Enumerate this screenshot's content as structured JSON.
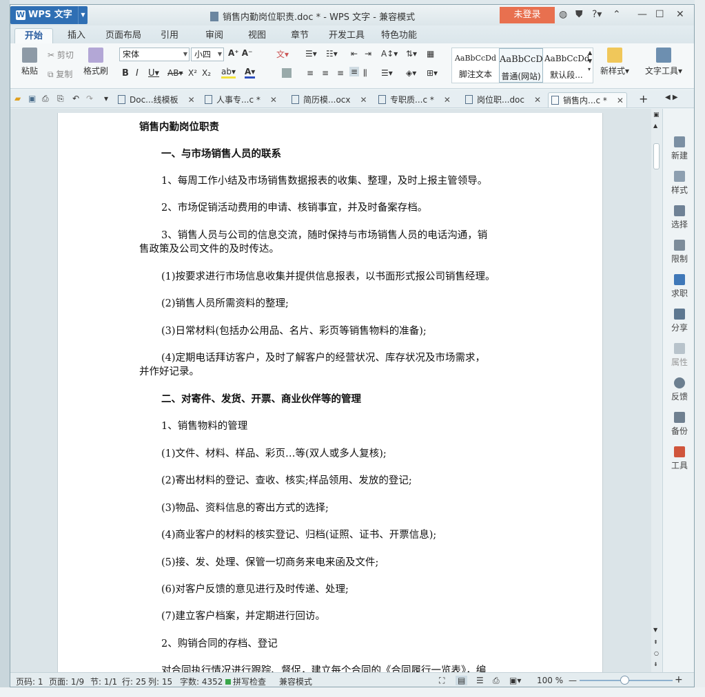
{
  "app": {
    "name": "WPS 文字",
    "title": "销售内勤岗位职责.doc * - WPS 文字 - 兼容模式",
    "login_label": "未登录"
  },
  "menu_tabs": [
    "开始",
    "插入",
    "页面布局",
    "引用",
    "审阅",
    "视图",
    "章节",
    "开发工具",
    "特色功能"
  ],
  "ribbon": {
    "paste": "粘贴",
    "cut": "剪切",
    "copy": "复制",
    "format_painter": "格式刷",
    "font_name": "宋体",
    "font_size": "小四",
    "styles": [
      {
        "preview": "AaBbCcDd",
        "label": "脚注文本"
      },
      {
        "preview": "AaBbCcD",
        "label": "普通(网站)"
      },
      {
        "preview": "AaBbCcDd",
        "label": "默认段..."
      }
    ],
    "new_style": "新样式",
    "text_tools": "文字工具"
  },
  "doc_tabs": [
    {
      "label": "Doc...线模板"
    },
    {
      "label": "人事专...c *"
    },
    {
      "label": "简历模...ocx"
    },
    {
      "label": "专职质...c *"
    },
    {
      "label": "岗位职...doc"
    },
    {
      "label": "销售内...c *"
    }
  ],
  "document": {
    "lines": [
      "销售内勤岗位职责",
      "一、与市场销售人员的联系",
      "1、每周工作小结及市场销售数据报表的收集、整理，及时上报主管领导。",
      "2、市场促销活动费用的申请、核销事宜，并及时备案存档。",
      "3、销售人员与公司的信息交流，随时保持与市场销售人员的电话沟通，销",
      "售政策及公司文件的及时传达。",
      "(1)按要求进行市场信息收集并提供信息报表，以书面形式报公司销售经理。",
      "(2)销售人员所需资料的整理;",
      "(3)日常材料(包括办公用品、名片、彩页等销售物料的准备);",
      "(4)定期电话拜访客户，及时了解客户的经营状况、库存状况及市场需求，",
      "并作好记录。",
      "二、对寄件、发货、开票、商业伙伴等的管理",
      "1、销售物料的管理",
      "(1)文件、材料、样品、彩页…等(双人或多人复核);",
      "(2)寄出材料的登记、查收、核实;样品领用、发放的登记;",
      "(3)物品、资料信息的寄出方式的选择;",
      "(4)商业客户的材料的核实登记、归档(证照、证书、开票信息);",
      "(5)接、发、处理、保管一切商务来电来函及文件;",
      "(6)对客户反馈的意见进行及时传递、处理;",
      "(7)建立客户档案，并定期进行回访。",
      "2、购销合同的存档、登记",
      "对合同执行情况进行跟踪、督促，建立每个合同的《合同履行一览表》，编"
    ]
  },
  "side_panel": [
    "新建",
    "样式",
    "选择",
    "限制",
    "求职",
    "分享",
    "属性",
    "反馈",
    "备份",
    "工具"
  ],
  "status": {
    "page_no": "页码: 1",
    "pages": "页面: 1/9",
    "section": "节: 1/1",
    "row": "行: 25",
    "col": "列: 15",
    "words": "字数: 4352",
    "spell": "拼写检查",
    "mode": "兼容模式",
    "zoom": "100 %"
  },
  "colors": {
    "accent": "#2f6fb4",
    "login": "#e8704f"
  }
}
